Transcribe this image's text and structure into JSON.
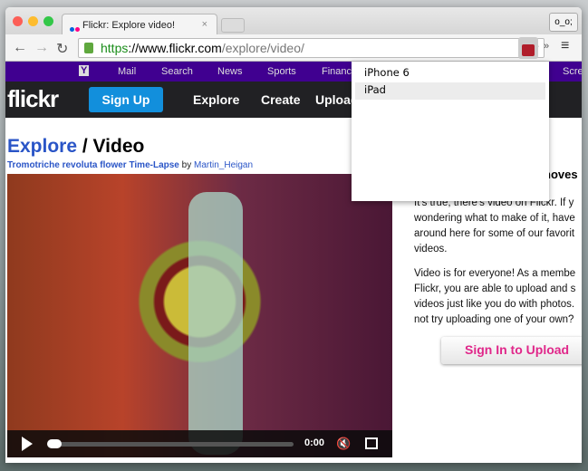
{
  "browser": {
    "tab_title": "Flickr: Explore video!",
    "profile": "o_o;",
    "url_scheme": "https",
    "url_host": "://www.flickr.com",
    "url_path": "/explore/video/"
  },
  "yahoo_bar": {
    "logo": "Y",
    "items": [
      "Mail",
      "Search",
      "News",
      "Sports",
      "Financ",
      "Scre"
    ]
  },
  "flickr_bar": {
    "logo": "flickr",
    "signup": "Sign Up",
    "items": [
      "Explore",
      "Create",
      "Upload"
    ]
  },
  "page": {
    "title_link": "Explore",
    "title_rest": " / Video",
    "video_title": "Tromotriche revoluta flower Time-Lapse",
    "by": " by ",
    "author": "Martin_Heigan",
    "time": "0:00",
    "side_heading": "noves",
    "para1": [
      "It's true, there's video on Flickr. If y",
      "wondering what to make of it, have",
      "around here for some of our favorit",
      "videos."
    ],
    "para2": [
      "Video is for everyone! As a membe",
      "Flickr, you are able to upload and s",
      "videos just like you do with photos.",
      "not try uploading one of your own?"
    ],
    "upload_button": "Sign In to Upload"
  },
  "dropdown": {
    "items": [
      "iPhone 6",
      "iPad"
    ],
    "selected": 1
  }
}
